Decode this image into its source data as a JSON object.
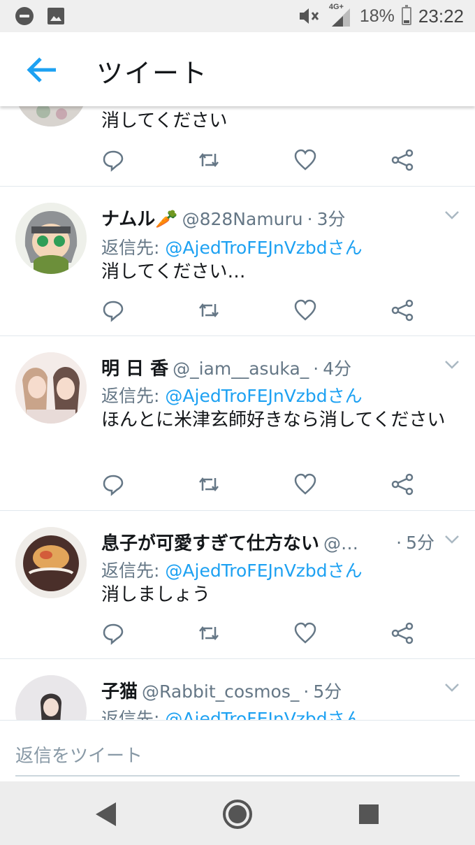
{
  "status_bar": {
    "network": "4G+",
    "battery": "18%",
    "battery_level": 0.18,
    "time": "23:22",
    "icons": [
      "do-not-disturb-icon",
      "image-notification-icon",
      "mute-icon",
      "signal-icon",
      "battery-icon"
    ]
  },
  "header": {
    "title": "ツイート",
    "back_icon": "arrow-left-icon"
  },
  "colors": {
    "accent": "#1da1f2",
    "text": "#14171a",
    "secondary": "#657786",
    "divider": "#e1e8ed"
  },
  "tweets": [
    {
      "text": "消してください"
    },
    {
      "name": "ナムル🥕",
      "handle": "@828Namuru",
      "time": "3分",
      "reply_label": "返信先:",
      "reply_target": "@AjedTroFEJnVzbdさん",
      "text": "消してください…"
    },
    {
      "name": "明 日 香",
      "handle": "@_iam__asuka_",
      "time": "4分",
      "reply_label": "返信先:",
      "reply_target": "@AjedTroFEJnVzbdさん",
      "text": "ほんとに米津玄師好きなら消してください"
    },
    {
      "name": "息子が可愛すぎて仕方ない",
      "handle": "@…",
      "time": "5分",
      "reply_label": "返信先:",
      "reply_target": "@AjedTroFEJnVzbdさん",
      "text": "消しましょう"
    },
    {
      "name": "子猫",
      "handle": "@Rabbit_cosmos_",
      "time": "5分",
      "reply_label": "返信先:",
      "reply_target": "@AjedTroFEJnVzbdさん"
    }
  ],
  "actions": {
    "icons": [
      "reply-icon",
      "retweet-icon",
      "like-icon",
      "share-icon"
    ]
  },
  "composer": {
    "placeholder": "返信をツイート"
  },
  "nav": {
    "icons": [
      "back-triangle-icon",
      "home-circle-icon",
      "recents-square-icon"
    ]
  }
}
